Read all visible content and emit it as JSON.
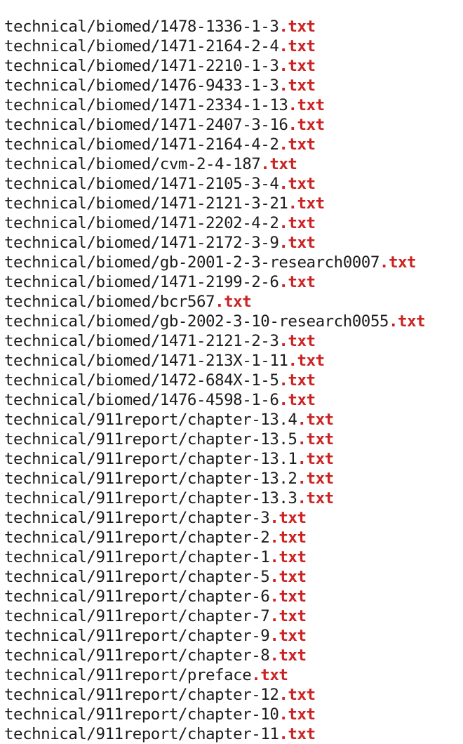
{
  "extension_color": "#cc2222",
  "files": [
    {
      "path": "technical/biomed/1478-1336-1-3",
      "ext": ".txt"
    },
    {
      "path": "technical/biomed/1471-2164-2-4",
      "ext": ".txt"
    },
    {
      "path": "technical/biomed/1471-2210-1-3",
      "ext": ".txt"
    },
    {
      "path": "technical/biomed/1476-9433-1-3",
      "ext": ".txt"
    },
    {
      "path": "technical/biomed/1471-2334-1-13",
      "ext": ".txt"
    },
    {
      "path": "technical/biomed/1471-2407-3-16",
      "ext": ".txt"
    },
    {
      "path": "technical/biomed/1471-2164-4-2",
      "ext": ".txt"
    },
    {
      "path": "technical/biomed/cvm-2-4-187",
      "ext": ".txt"
    },
    {
      "path": "technical/biomed/1471-2105-3-4",
      "ext": ".txt"
    },
    {
      "path": "technical/biomed/1471-2121-3-21",
      "ext": ".txt"
    },
    {
      "path": "technical/biomed/1471-2202-4-2",
      "ext": ".txt"
    },
    {
      "path": "technical/biomed/1471-2172-3-9",
      "ext": ".txt"
    },
    {
      "path": "technical/biomed/gb-2001-2-3-research0007",
      "ext": ".txt"
    },
    {
      "path": "technical/biomed/1471-2199-2-6",
      "ext": ".txt"
    },
    {
      "path": "technical/biomed/bcr567",
      "ext": ".txt"
    },
    {
      "path": "technical/biomed/gb-2002-3-10-research0055",
      "ext": ".txt"
    },
    {
      "path": "technical/biomed/1471-2121-2-3",
      "ext": ".txt"
    },
    {
      "path": "technical/biomed/1471-213X-1-11",
      "ext": ".txt"
    },
    {
      "path": "technical/biomed/1472-684X-1-5",
      "ext": ".txt"
    },
    {
      "path": "technical/biomed/1476-4598-1-6",
      "ext": ".txt"
    },
    {
      "path": "technical/911report/chapter-13.4",
      "ext": ".txt"
    },
    {
      "path": "technical/911report/chapter-13.5",
      "ext": ".txt"
    },
    {
      "path": "technical/911report/chapter-13.1",
      "ext": ".txt"
    },
    {
      "path": "technical/911report/chapter-13.2",
      "ext": ".txt"
    },
    {
      "path": "technical/911report/chapter-13.3",
      "ext": ".txt"
    },
    {
      "path": "technical/911report/chapter-3",
      "ext": ".txt"
    },
    {
      "path": "technical/911report/chapter-2",
      "ext": ".txt"
    },
    {
      "path": "technical/911report/chapter-1",
      "ext": ".txt"
    },
    {
      "path": "technical/911report/chapter-5",
      "ext": ".txt"
    },
    {
      "path": "technical/911report/chapter-6",
      "ext": ".txt"
    },
    {
      "path": "technical/911report/chapter-7",
      "ext": ".txt"
    },
    {
      "path": "technical/911report/chapter-9",
      "ext": ".txt"
    },
    {
      "path": "technical/911report/chapter-8",
      "ext": ".txt"
    },
    {
      "path": "technical/911report/preface",
      "ext": ".txt"
    },
    {
      "path": "technical/911report/chapter-12",
      "ext": ".txt"
    },
    {
      "path": "technical/911report/chapter-10",
      "ext": ".txt"
    },
    {
      "path": "technical/911report/chapter-11",
      "ext": ".txt"
    }
  ]
}
